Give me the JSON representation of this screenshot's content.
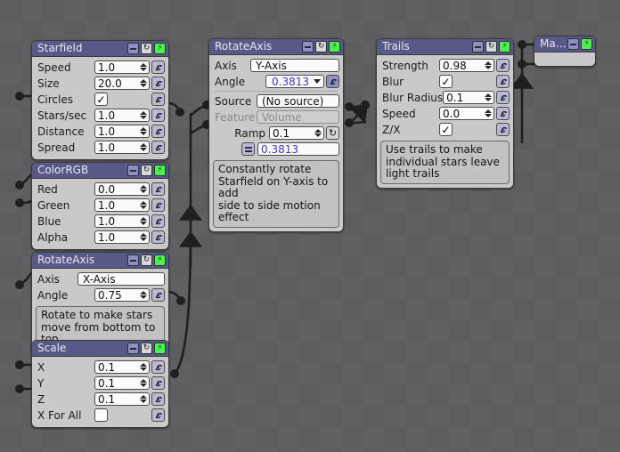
{
  "app": {
    "kind": "node-graph-editor",
    "background": "#5d5d5f",
    "header_color": "#595988",
    "node_body_color": "#c9c9c9",
    "accent_green": "#4ef24e",
    "driven_value_color": "#3a3ad8"
  },
  "icons": {
    "minimize": "minimize-icon",
    "refresh": "refresh-icon",
    "bolt": "lightning-bolt-icon",
    "link": "chain-link-icon",
    "equals": "equals-menu-icon",
    "checkmark": "✓",
    "dropdown": "chevron-down-icon"
  },
  "nodes": [
    {
      "id": "starfield",
      "title": "Starfield",
      "rows": [
        {
          "label": "Speed",
          "type": "number",
          "value": "1.0",
          "link": true
        },
        {
          "label": "Size",
          "type": "number",
          "value": "20.0",
          "link": true
        },
        {
          "label": "Circles",
          "type": "checkbox",
          "value": "✓",
          "checked": true,
          "link": true
        },
        {
          "label": "Stars/sec",
          "type": "number",
          "value": "1.0",
          "link": true
        },
        {
          "label": "Distance",
          "type": "number",
          "value": "1.0",
          "link": true
        },
        {
          "label": "Spread",
          "type": "number",
          "value": "1.0",
          "link": true
        }
      ]
    },
    {
      "id": "colorrgb",
      "title": "ColorRGB",
      "rows": [
        {
          "label": "Red",
          "type": "number",
          "value": "0.0",
          "link": true
        },
        {
          "label": "Green",
          "type": "number",
          "value": "1.0",
          "link": true
        },
        {
          "label": "Blue",
          "type": "number",
          "value": "1.0",
          "link": true
        },
        {
          "label": "Alpha",
          "type": "number",
          "value": "1.0",
          "link": true
        }
      ]
    },
    {
      "id": "rotateaxis-x",
      "title": "RotateAxis",
      "rows": [
        {
          "label": "Axis",
          "type": "select",
          "value": "X-Axis"
        },
        {
          "label": "Angle",
          "type": "number",
          "value": "0.75",
          "link": true
        }
      ],
      "note": "Rotate to make stars\nmove from bottom to top"
    },
    {
      "id": "scale",
      "title": "Scale",
      "rows": [
        {
          "label": "X",
          "type": "number",
          "value": "0.1",
          "link": true
        },
        {
          "label": "Y",
          "type": "number",
          "value": "0.1",
          "link": true
        },
        {
          "label": "Z",
          "type": "number",
          "value": "0.1",
          "link": true
        },
        {
          "label": "X For All",
          "type": "checkbox",
          "value": "",
          "checked": false,
          "link": true
        }
      ]
    },
    {
      "id": "rotateaxis-y",
      "title": "RotateAxis",
      "rows": [
        {
          "label": "Axis",
          "type": "select",
          "value": "Y-Axis"
        },
        {
          "label": "Angle",
          "type": "driven",
          "value": "0.3813",
          "link": true
        },
        {
          "label": "Source",
          "type": "select",
          "value": "(No source)"
        },
        {
          "label": "Feature",
          "type": "select-disabled",
          "value": "Volume"
        },
        {
          "label": "Ramp",
          "type": "number-refresh",
          "value": "0.1"
        },
        {
          "label": "",
          "type": "equals-row",
          "value": "0.3813"
        }
      ],
      "note": "Constantly rotate\nStarfield on Y-axis to add\nside to side motion effect"
    },
    {
      "id": "trails",
      "title": "Trails",
      "rows": [
        {
          "label": "Strength",
          "type": "number",
          "value": "0.98",
          "link": true
        },
        {
          "label": "Blur",
          "type": "checkbox",
          "value": "✓",
          "checked": true,
          "link": true
        },
        {
          "label": "Blur Radius",
          "type": "number",
          "value": "0.1",
          "link": true
        },
        {
          "label": "Speed",
          "type": "number",
          "value": "0.0",
          "link": true
        },
        {
          "label": "Z/X",
          "type": "checkbox",
          "value": "✓",
          "checked": true,
          "link": true
        }
      ],
      "note": "Use trails to make\nindividual stars leave\nlight trails"
    },
    {
      "id": "magic",
      "title": "Magic",
      "rows": [],
      "note": null
    }
  ]
}
